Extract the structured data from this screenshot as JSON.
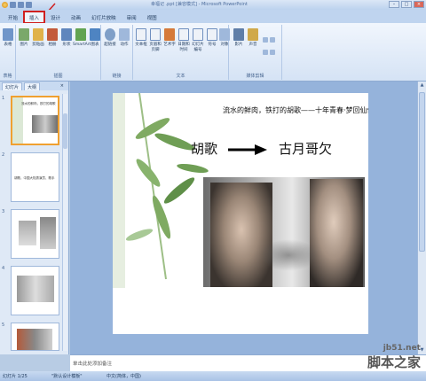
{
  "titlebar": {
    "title": "幸福记 .ppt [兼容模式] - Microsoft PowerPoint"
  },
  "tabs": [
    {
      "label": "开始"
    },
    {
      "label": "插入"
    },
    {
      "label": "设计"
    },
    {
      "label": "动画"
    },
    {
      "label": "幻灯片放映"
    },
    {
      "label": "审阅"
    },
    {
      "label": "视图"
    }
  ],
  "ribbon": {
    "groups": [
      {
        "label": "表格"
      },
      {
        "label": "插图"
      },
      {
        "label": "链接"
      },
      {
        "label": "文本"
      },
      {
        "label": "媒体剪辑"
      }
    ],
    "buttons": [
      {
        "label": "表格"
      },
      {
        "label": "图片"
      },
      {
        "label": "剪贴画"
      },
      {
        "label": "相册"
      },
      {
        "label": "形状"
      },
      {
        "label": "SmartArt"
      },
      {
        "label": "图表"
      },
      {
        "label": "超链接"
      },
      {
        "label": "动作"
      },
      {
        "label": "文本框"
      },
      {
        "label": "页眉和页脚"
      },
      {
        "label": "艺术字"
      },
      {
        "label": "日期和时间"
      },
      {
        "label": "幻灯片编号"
      },
      {
        "label": "符号"
      },
      {
        "label": "对象"
      },
      {
        "label": "影片"
      },
      {
        "label": "声音"
      }
    ]
  },
  "left_panel": {
    "tabs": [
      "幻灯片",
      "大纲"
    ],
    "thumbs": [
      {
        "num": "1",
        "title": "流水的鲜肉，铁打的胡歌"
      },
      {
        "num": "2",
        "title": "胡歌，中国大陆男演员、歌手"
      },
      {
        "num": "3",
        "title": ""
      },
      {
        "num": "4",
        "title": ""
      },
      {
        "num": "5",
        "title": ""
      }
    ]
  },
  "slide": {
    "top_text": "流水的鲜肉，铁打的胡歌——十年青春·梦回仙侠",
    "heading_left": "胡歌",
    "heading_right": "古月哥欠"
  },
  "notes": {
    "placeholder": "单击此处添加备注"
  },
  "statusbar": {
    "slide_count": "幻灯片 1/25",
    "theme": "\"默认设计模板\"",
    "language": "中文(简体，中国)"
  },
  "watermark": {
    "url": "jb51.net",
    "name": "脚本之家"
  },
  "colors": {
    "highlight_box": "#d02020",
    "ribbon_bg": "#dbe7f6"
  }
}
